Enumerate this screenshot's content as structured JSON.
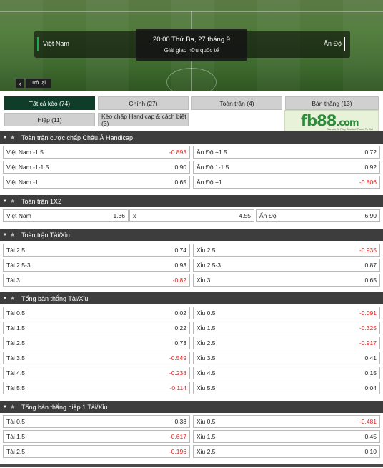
{
  "match": {
    "home": "Việt Nam",
    "away": "Ấn Độ",
    "kickoff": "20:00 Thứ Ba, 27 tháng 9",
    "league": "Giải giao hữu quốc tế",
    "back_label": "Trở lại"
  },
  "tabs": {
    "all": "Tất cả kèo (74)",
    "main": "Chính (27)",
    "full": "Toàn trận (4)",
    "goals": "Bàn thắng (13)",
    "half": "Hiệp (11)",
    "handicap": "Kèo chấp Handicap & cách biệt (3)"
  },
  "logo": {
    "brand": "fb88",
    "tld": ".com",
    "tagline": "Games To Play  Trusted Place To Bet"
  },
  "sections": {
    "ah": {
      "title": "Toàn trận cược chấp Châu Á Handicap",
      "rows": [
        {
          "l": "Việt Nam -1.5",
          "lv": "-0.893",
          "r": "Ấn Độ +1.5",
          "rv": "0.72"
        },
        {
          "l": "Việt Nam -1-1.5",
          "lv": "0.90",
          "r": "Ấn Độ 1-1.5",
          "rv": "0.92"
        },
        {
          "l": "Việt Nam -1",
          "lv": "0.65",
          "r": "Ấn Độ +1",
          "rv": "-0.806"
        }
      ]
    },
    "x12": {
      "title": "Toàn trận 1X2",
      "a": "Việt Nam",
      "av": "1.36",
      "b": "x",
      "bv": "4.55",
      "c": "Ấn Độ",
      "cv": "6.90"
    },
    "ou": {
      "title": "Toàn trận Tài/Xỉu",
      "rows": [
        {
          "l": "Tài 2.5",
          "lv": "0.74",
          "r": "Xỉu 2.5",
          "rv": "-0.935"
        },
        {
          "l": "Tài 2.5-3",
          "lv": "0.93",
          "r": "Xỉu 2.5-3",
          "rv": "0.87"
        },
        {
          "l": "Tài 3",
          "lv": "-0.82",
          "r": "Xỉu 3",
          "rv": "0.65"
        }
      ]
    },
    "goals": {
      "title": "Tổng bàn thắng Tài/Xỉu",
      "rows": [
        {
          "l": "Tài 0.5",
          "lv": "0.02",
          "r": "Xỉu 0.5",
          "rv": "-0.091"
        },
        {
          "l": "Tài 1.5",
          "lv": "0.22",
          "r": "Xỉu 1.5",
          "rv": "-0.325"
        },
        {
          "l": "Tài 2.5",
          "lv": "0.73",
          "r": "Xỉu 2.5",
          "rv": "-0.917"
        },
        {
          "l": "Tài 3.5",
          "lv": "-0.549",
          "r": "Xỉu 3.5",
          "rv": "0.41"
        },
        {
          "l": "Tài 4.5",
          "lv": "-0.238",
          "r": "Xỉu 4.5",
          "rv": "0.15"
        },
        {
          "l": "Tài 5.5",
          "lv": "-0.114",
          "r": "Xỉu 5.5",
          "rv": "0.04"
        }
      ]
    },
    "h1": {
      "title": "Tổng bàn thắng hiệp 1 Tài/Xỉu",
      "rows": [
        {
          "l": "Tài 0.5",
          "lv": "0.33",
          "r": "Xỉu 0.5",
          "rv": "-0.481"
        },
        {
          "l": "Tài 1.5",
          "lv": "-0.617",
          "r": "Xỉu 1.5",
          "rv": "0.45"
        },
        {
          "l": "Tài 2.5",
          "lv": "-0.196",
          "r": "Xỉu 2.5",
          "rv": "0.10"
        }
      ]
    }
  },
  "colors": {
    "active_tab": "#0f3d2a",
    "section_header": "#3d3d3d",
    "negative": "#e31d1d"
  },
  "icons": {
    "back": "chevron-left-icon",
    "collapse": "caret-down-icon",
    "favorite": "star-icon"
  }
}
